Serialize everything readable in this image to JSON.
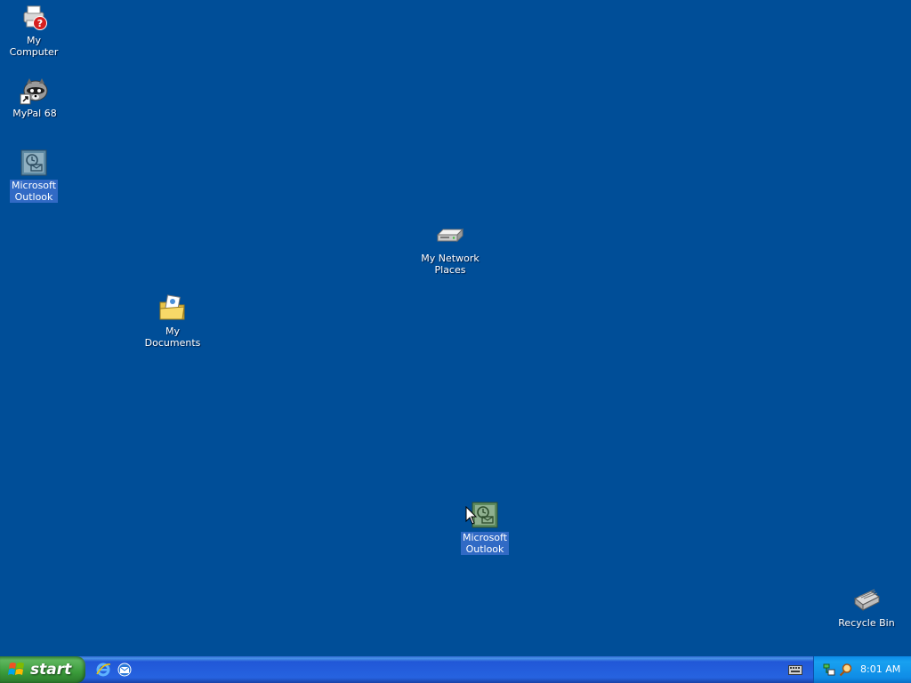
{
  "desktop": {
    "background_color": "#004e98",
    "icons": {
      "my_computer": {
        "label": "My Computer",
        "icon": "printer-help-icon"
      },
      "mypal": {
        "label": "MyPal 68",
        "icon": "raccoon-shortcut-icon"
      },
      "outlook_left": {
        "label": "Microsoft\nOutlook",
        "icon": "outlook-icon",
        "selected": true
      },
      "network": {
        "label": "My Network\nPlaces",
        "icon": "network-drive-icon"
      },
      "documents": {
        "label": "My Documents",
        "icon": "documents-folder-icon"
      },
      "outlook_drag": {
        "label": "Microsoft\nOutlook",
        "icon": "outlook-icon",
        "selected": true
      },
      "recycle": {
        "label": "Recycle Bin",
        "icon": "recycle-bin-icon"
      }
    }
  },
  "taskbar": {
    "start_label": "start",
    "quick_launch": [
      "internet-explorer-icon",
      "outlook-express-icon"
    ],
    "tray": {
      "icons": [
        "network-tray-icon",
        "search-tray-icon"
      ],
      "clock": "8:01 AM"
    }
  },
  "colors": {
    "selection": "#316ac5",
    "taskbar": "#245edb",
    "start": "#3c9a3c",
    "tray": "#0f8ce6"
  }
}
